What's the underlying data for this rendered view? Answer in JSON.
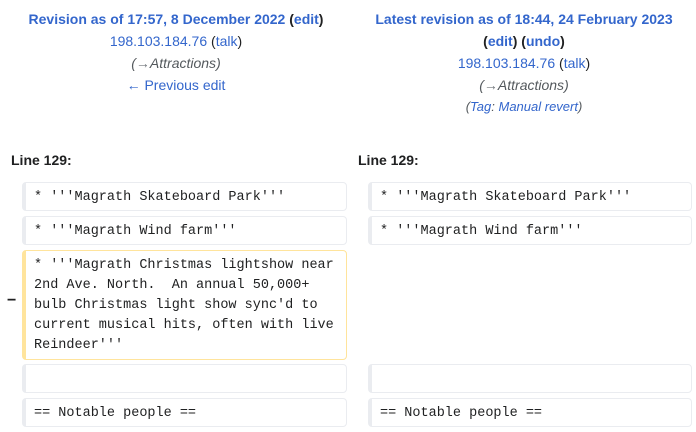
{
  "left_header": {
    "title": "Revision as of 17:57, 8 December 2022",
    "edit": "edit",
    "user": "198.103.184.76",
    "talk": "talk",
    "summary_arrow": "→",
    "summary_section": "Attractions",
    "prev": "← Previous edit"
  },
  "right_header": {
    "title": "Latest revision as of 18:44, 24 February 2023",
    "edit": "edit",
    "undo": "undo",
    "user": "198.103.184.76",
    "talk": "talk",
    "summary_arrow": "→",
    "summary_section": "Attractions",
    "tag_label": "Tag",
    "tag_value": "Manual revert"
  },
  "diff": {
    "left_line": "Line 129:",
    "right_line": "Line 129:",
    "marker": "−",
    "rows": [
      {
        "left": "* '''Magrath Skateboard Park'''",
        "right": "* '''Magrath Skateboard Park'''"
      },
      {
        "left": "* '''Magrath Wind farm'''",
        "right": "* '''Magrath Wind farm'''"
      },
      {
        "left": "* '''Magrath Christmas lightshow near 2nd Ave. North.  An annual 50,000+ bulb Christmas light show sync'd to current musical hits, often with live Reindeer'''",
        "right": ""
      },
      {
        "left": "",
        "right": ""
      },
      {
        "left": "== Notable people ==",
        "right": "== Notable people =="
      }
    ]
  }
}
